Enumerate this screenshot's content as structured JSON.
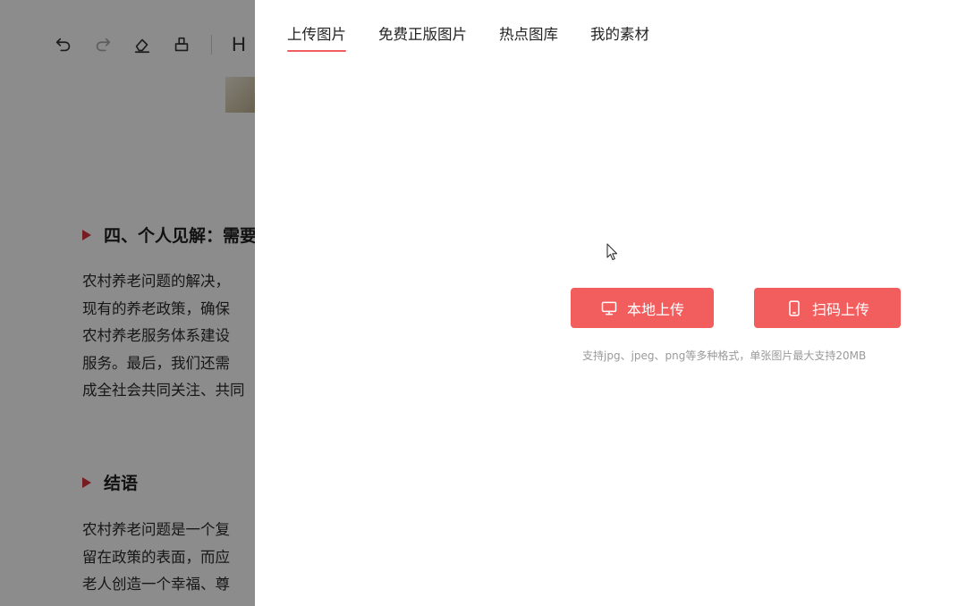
{
  "editor": {
    "toolbar": {
      "icons": [
        "undo-icon",
        "redo-icon",
        "eraser-icon",
        "format-painter-icon"
      ],
      "heading_label": "H"
    },
    "sections": [
      {
        "heading": "四、个人见解：需要",
        "lines": [
          "农村养老问题的解决，",
          "现有的养老政策，确保",
          "农村养老服务体系建设",
          "服务。最后，我们还需",
          "成全社会共同关注、共同"
        ]
      },
      {
        "heading": "结语",
        "lines": [
          "农村养老问题是一个复",
          "留在政策的表面，而应",
          "老人创造一个幸福、尊"
        ]
      }
    ]
  },
  "drawer": {
    "tabs": [
      {
        "label": "上传图片",
        "active": true
      },
      {
        "label": "免费正版图片",
        "active": false
      },
      {
        "label": "热点图库",
        "active": false
      },
      {
        "label": "我的素材",
        "active": false
      }
    ],
    "local_upload_label": "本地上传",
    "scan_upload_label": "扫码上传",
    "upload_hint": "支持jpg、jpeg、png等多种格式，单张图片最大支持20MB",
    "accent_color": "#f25d5d"
  }
}
